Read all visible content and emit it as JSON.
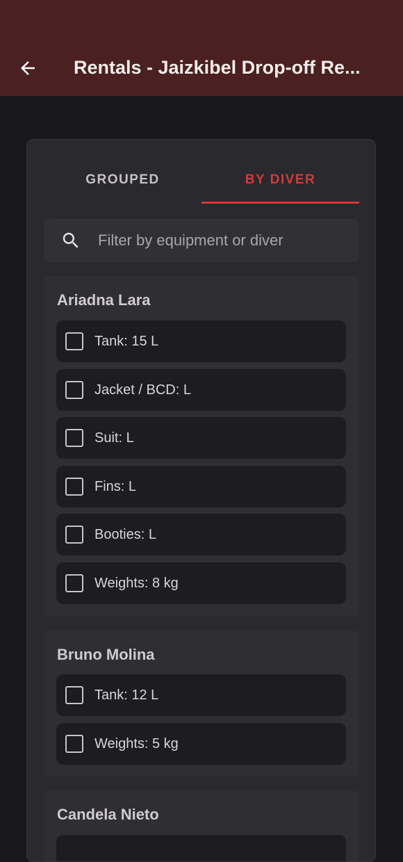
{
  "appbar": {
    "title": "Rentals - Jaizkibel Drop-off Re..."
  },
  "tabs": [
    {
      "label": "GROUPED",
      "active": false
    },
    {
      "label": "BY DIVER",
      "active": true
    }
  ],
  "search": {
    "placeholder": "Filter by equipment or diver",
    "value": ""
  },
  "divers": [
    {
      "name": "Ariadna Lara",
      "items": [
        "Tank: 15 L",
        "Jacket / BCD: L",
        "Suit: L",
        "Fins: L",
        "Booties: L",
        "Weights: 8 kg"
      ]
    },
    {
      "name": "Bruno Molina",
      "items": [
        "Tank: 12 L",
        "Weights: 5 kg"
      ]
    },
    {
      "name": "Candela Nieto",
      "items": []
    }
  ],
  "colors": {
    "appbar": "#4a2020",
    "accent": "#d23a3a",
    "background": "#19181a"
  }
}
